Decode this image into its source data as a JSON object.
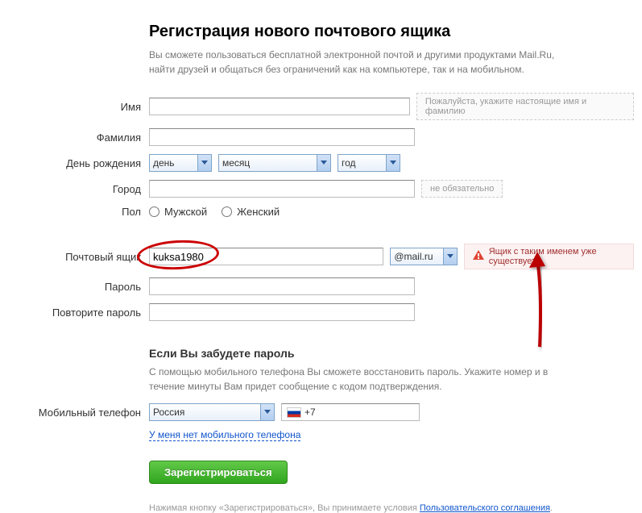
{
  "header": {
    "title": "Регистрация нового почтового ящика",
    "subtitle": "Вы сможете пользоваться бесплатной электронной почтой и другими продуктами Mail.Ru, найти друзей и общаться без ограничений как на компьютере, так и на мобильном."
  },
  "labels": {
    "firstname": "Имя",
    "lastname": "Фамилия",
    "birthday": "День рождения",
    "city": "Город",
    "gender": "Пол",
    "mailbox": "Почтовый ящик",
    "password": "Пароль",
    "password2": "Повторите пароль",
    "phone": "Мобильный телефон"
  },
  "birthday": {
    "day": "день",
    "month": "месяц",
    "year": "год"
  },
  "city": {
    "hint": "не обязательно"
  },
  "gender": {
    "male": "Мужской",
    "female": "Женский"
  },
  "mailbox": {
    "value": "kuksa1980",
    "domain": "@mail.ru",
    "error": "Ящик с таким именем уже существует"
  },
  "name_hint": "Пожалуйста, укажите настоящие имя и фамилию",
  "recovery": {
    "title": "Если Вы забудете пароль",
    "text": "С помощью мобильного телефона Вы сможете восстановить пароль. Укажите номер и в течение минуты Вам придет сообщение с кодом подтверждения.",
    "country": "Россия",
    "prefix": "+7",
    "no_phone_link": "У меня нет мобильного телефона"
  },
  "submit": {
    "label": "Зарегистрироваться"
  },
  "footer": {
    "text_before": "Нажимая кнопку «Зарегистрироваться», Вы принимаете условия ",
    "link": "Пользовательского соглашения",
    "text_after": "."
  }
}
